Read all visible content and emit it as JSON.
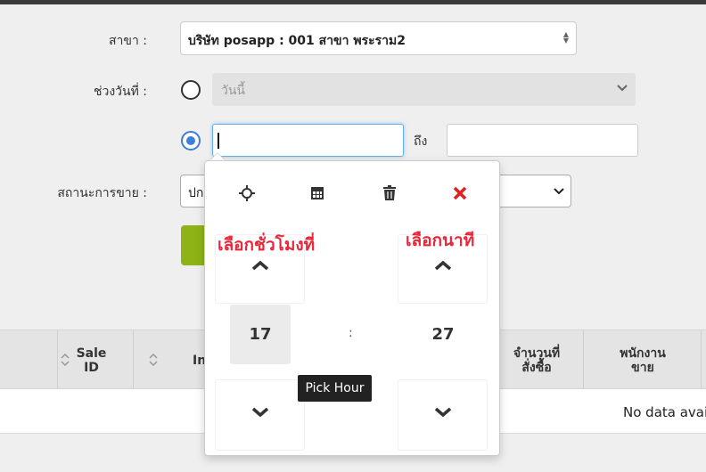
{
  "form": {
    "branch_label": "สาขา :",
    "branch_value": "บริษัท posapp : 001 สาขา พระราม2",
    "date_range_label": "ช่วงวันที่ :",
    "day_option_value": "วันนี้",
    "custom_from_value": "",
    "to_label": "ถึง",
    "custom_to_value": "",
    "sale_status_label": "สถานะการขาย :",
    "sale_status_value": "ปก"
  },
  "table": {
    "columns": [
      {
        "label_line1": "Sale",
        "label_line2": "ID"
      },
      {
        "label_line1": "In",
        "label_line2": ""
      },
      {
        "label_line1": "จำนวนที่",
        "label_line2": "สั่งซื้อ"
      },
      {
        "label_line1": "พนักงาน",
        "label_line2": "ขาย"
      }
    ],
    "empty_text": "No data avail"
  },
  "time_picker": {
    "icons": [
      "crosshair-icon",
      "calendar-icon",
      "trash-icon",
      "close-icon"
    ],
    "hour": "17",
    "minute": "27",
    "separator": ":",
    "tooltip": "Pick Hour"
  },
  "annotations": {
    "pick_hour": "เลือกชั่วโมงที่",
    "pick_minute": "เลือกนาที"
  },
  "colors": {
    "accent_blue": "#3d7fd9",
    "button_green": "#8db317",
    "annotation_red": "#e8283a",
    "close_red": "#e0201e"
  }
}
